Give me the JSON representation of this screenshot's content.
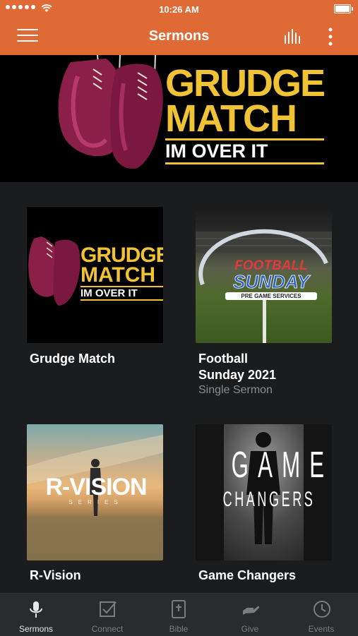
{
  "status_bar": {
    "time": "10:26 AM"
  },
  "app_bar": {
    "title": "Sermons"
  },
  "hero": {
    "line1": "GRUDGE",
    "line2": "MATCH",
    "sub": "IM OVER IT"
  },
  "sermons": [
    {
      "title": "Grudge Match",
      "subtitle": "",
      "art": {
        "line1": "GRUDGE",
        "line2": "MATCH",
        "sub": "IM OVER IT"
      }
    },
    {
      "title": "Football Sunday 2021",
      "title_line1": "Football",
      "title_line2": "Sunday 2021",
      "subtitle": "Single Sermon",
      "art": {
        "line1": "FOOTBALL",
        "line2": "SUNDAY",
        "sub": "PRE GAME SERVICES"
      }
    },
    {
      "title": "R-Vision",
      "subtitle": "",
      "art": {
        "line1": "R-VISION",
        "sub": "SERIES"
      }
    },
    {
      "title": "Game Changers",
      "subtitle": "",
      "art": {
        "line1": "GAME",
        "line2": "CHANGERS"
      }
    }
  ],
  "tabs": [
    {
      "label": "Sermons",
      "icon": "microphone-icon",
      "active": true
    },
    {
      "label": "Connect",
      "icon": "checkbox-icon",
      "active": false
    },
    {
      "label": "Bible",
      "icon": "bible-icon",
      "active": false
    },
    {
      "label": "Give",
      "icon": "give-hand-icon",
      "active": false
    },
    {
      "label": "Events",
      "icon": "clock-icon",
      "active": false
    }
  ],
  "colors": {
    "accent": "#e06a35",
    "background": "#1b1c1e",
    "tab_bar": "#2a2b2e",
    "logo_gold": "#f0c236"
  }
}
